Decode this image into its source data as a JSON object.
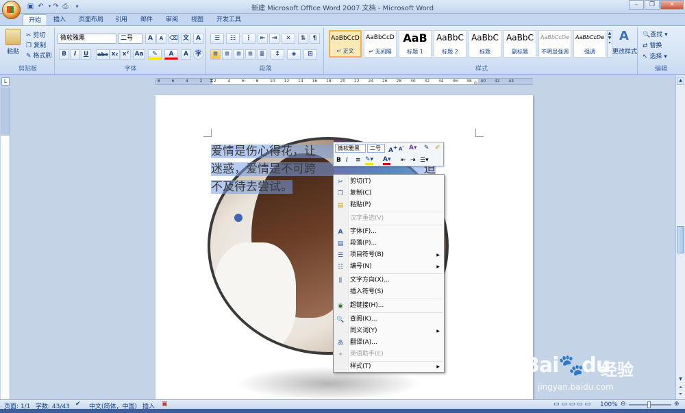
{
  "window": {
    "title": "新建 Microsoft Office Word 2007 文档 - Microsoft Word"
  },
  "qat": {
    "save": "save-icon",
    "undo": "undo-icon",
    "redo": "redo-icon",
    "print": "print-icon",
    "more": "▾"
  },
  "tabs": [
    "开始",
    "插入",
    "页面布局",
    "引用",
    "邮件",
    "审阅",
    "视图",
    "开发工具"
  ],
  "clipboard": {
    "paste": "粘贴",
    "cut": "剪切",
    "copy": "复制",
    "format_painter": "格式刷",
    "group_label": "剪贴板"
  },
  "font": {
    "family": "微软雅黑",
    "size": "二号",
    "group_label": "字体",
    "grow": "A",
    "shrink": "A",
    "bold": "B",
    "italic": "I",
    "underline": "U",
    "strike": "abc",
    "sub": "x₂",
    "sup": "x²",
    "case": "Aa",
    "highlight_color": "#f5e400",
    "font_color": "#e00000"
  },
  "paragraph": {
    "group_label": "段落"
  },
  "styles": {
    "group_label": "样式",
    "items": [
      {
        "sample": "AaBbCcD",
        "name": "↵ 正文"
      },
      {
        "sample": "AaBbCcD",
        "name": "↵ 无间隔"
      },
      {
        "sample": "AaB",
        "name": "标题 1"
      },
      {
        "sample": "AaBbC",
        "name": "标题 2"
      },
      {
        "sample": "AaBbC",
        "name": "标题"
      },
      {
        "sample": "AaBbC",
        "name": "副标题"
      },
      {
        "sample": "AaBbCcDe",
        "name": "不明显强调"
      },
      {
        "sample": "AaBbCcDe",
        "name": "强调"
      }
    ],
    "change": "更改样式"
  },
  "editing": {
    "find": "查找",
    "replace": "替换",
    "select": "选择",
    "group_label": "编辑"
  },
  "ruler": {
    "ticks": [
      "8",
      "6",
      "4",
      "2",
      "2",
      "4",
      "6",
      "8",
      "10",
      "12",
      "14",
      "16",
      "18",
      "20",
      "22",
      "24",
      "26",
      "28",
      "30",
      "32",
      "34",
      "36",
      "38",
      "40",
      "42",
      "44"
    ]
  },
  "document": {
    "line1": "爱情是伤心得花，让",
    "line1b": "所",
    "line2": "迷惑，爱情是不可跨",
    "line2b": "迫",
    "line3": "不及待去尝试。"
  },
  "mini_toolbar": {
    "font": "微软雅黑",
    "size": "二号"
  },
  "context_menu": {
    "items": [
      {
        "label": "剪切(T)",
        "icon": "scissors-icon",
        "sub": false,
        "disabled": false
      },
      {
        "label": "复制(C)",
        "icon": "copy-icon",
        "sub": false,
        "disabled": false
      },
      {
        "label": "粘贴(P)",
        "icon": "paste-icon",
        "sub": false,
        "disabled": false
      },
      {
        "label": "汉字重选(V)",
        "icon": "",
        "sub": false,
        "disabled": true
      },
      {
        "label": "字体(F)...",
        "icon": "font-icon",
        "sub": false,
        "disabled": false
      },
      {
        "label": "段落(P)...",
        "icon": "paragraph-icon",
        "sub": false,
        "disabled": false
      },
      {
        "label": "项目符号(B)",
        "icon": "bullets-icon",
        "sub": true,
        "disabled": false
      },
      {
        "label": "编号(N)",
        "icon": "numbering-icon",
        "sub": true,
        "disabled": false
      },
      {
        "label": "文字方向(X)...",
        "icon": "text-direction-icon",
        "sub": false,
        "disabled": false
      },
      {
        "label": "插入符号(S)",
        "icon": "",
        "sub": false,
        "disabled": false
      },
      {
        "label": "超链接(H)...",
        "icon": "hyperlink-icon",
        "sub": false,
        "disabled": false
      },
      {
        "label": "查阅(K)...",
        "icon": "lookup-icon",
        "sub": false,
        "disabled": false
      },
      {
        "label": "同义词(Y)",
        "icon": "",
        "sub": true,
        "disabled": false
      },
      {
        "label": "翻译(A)...",
        "icon": "translate-icon",
        "sub": false,
        "disabled": false
      },
      {
        "label": "英语助手(E)",
        "icon": "english-assistant-icon",
        "sub": false,
        "disabled": true
      },
      {
        "label": "样式(T)",
        "icon": "",
        "sub": true,
        "disabled": false
      }
    ]
  },
  "statusbar": {
    "page": "页面: 1/1",
    "words": "字数: 43/43",
    "language": "中文(简体，中国)",
    "mode": "插入",
    "zoom": "100%"
  },
  "watermark": {
    "brand": "Bai",
    "brand2": "du",
    "jy": "经验",
    "url": "jingyan.baidu.com"
  }
}
